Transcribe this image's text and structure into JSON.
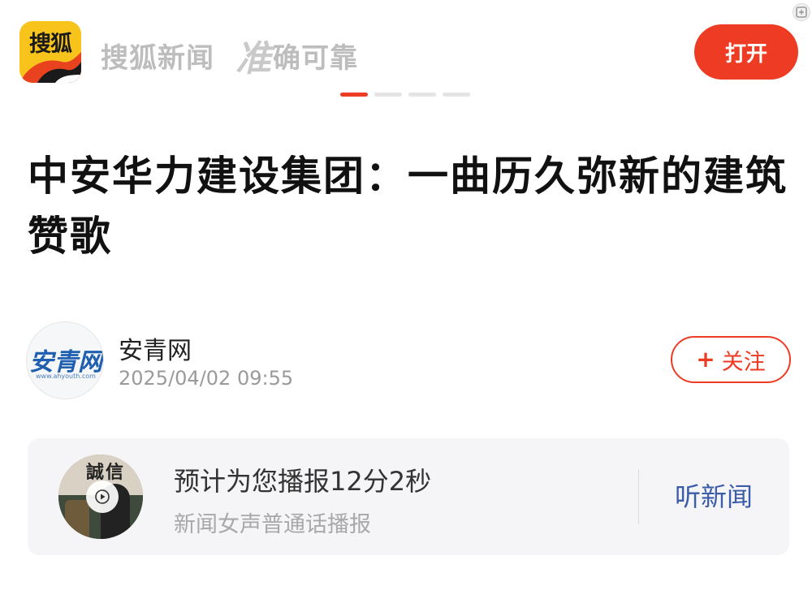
{
  "app": {
    "logo_text": "搜狐",
    "slogan_main": "搜狐新闻",
    "slogan_calligraphy": "准",
    "slogan_rest": "确可靠",
    "open_button_label": "打开"
  },
  "carousel": {
    "count": 4,
    "active_index": 0
  },
  "article": {
    "title": "中安华力建设集团：一曲历久弥新的建筑赞歌"
  },
  "author": {
    "avatar_text": "安青网",
    "avatar_url_text": "www.ahyouth.com",
    "name": "安青网",
    "publish_time": "2025/04/02 09:55",
    "follow_label": "关注"
  },
  "audio": {
    "cover_text": "誠信",
    "title": "预计为您播报12分2秒",
    "subtitle": "新闻女声普通话播报",
    "listen_label": "听新闻"
  },
  "colors": {
    "accent": "#ee3b24",
    "listen_link": "#3b5da8",
    "card_bg": "#f5f5f7"
  }
}
